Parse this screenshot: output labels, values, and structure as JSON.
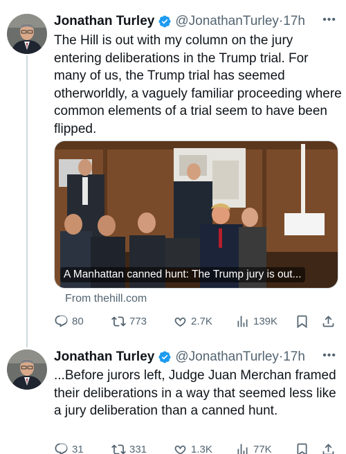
{
  "tweets": [
    {
      "author_name": "Jonathan Turley",
      "handle": "@JonathanTurley",
      "separator": "·",
      "time": "17h",
      "more_label": "•••",
      "text": "The Hill is out with my column on the jury entering deliberations in the Trump trial. For many of us, the Trump trial has seemed otherworldly, a vaguely familiar proceeding where common elements of a trial seem to have been flipped.",
      "card": {
        "title": "A Manhattan canned hunt: The Trump jury is out...",
        "source": "From thehill.com"
      },
      "stats": {
        "replies": "80",
        "reposts": "773",
        "likes": "2.7K",
        "views": "139K"
      }
    },
    {
      "author_name": "Jonathan Turley",
      "handle": "@JonathanTurley",
      "separator": "·",
      "time": "17h",
      "more_label": "•••",
      "text": "...Before jurors left, Judge Juan Merchan framed their deliberations in a way that seemed less like a jury deliberation than a canned hunt.",
      "stats": {
        "replies": "31",
        "reposts": "331",
        "likes": "1.3K",
        "views": "77K"
      }
    }
  ],
  "colors": {
    "verified": "#1d9bf0",
    "muted": "#536471",
    "text": "#0f1419",
    "thread_line": "#cfd9de"
  },
  "icons": [
    "reply-icon",
    "repost-icon",
    "like-icon",
    "views-icon",
    "bookmark-icon",
    "share-icon",
    "verified-badge-icon",
    "more-icon"
  ]
}
